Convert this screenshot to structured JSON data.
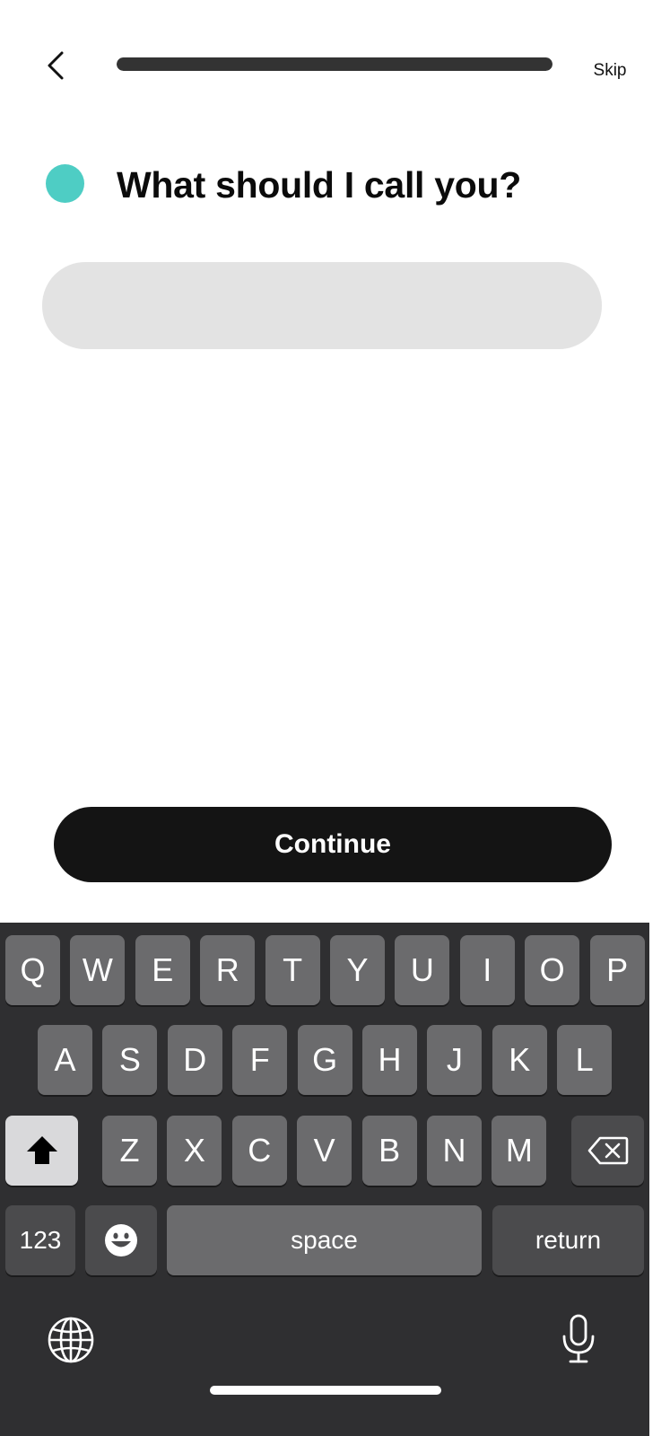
{
  "header": {
    "back_icon": "chevron-left-icon",
    "progress": 1.0,
    "skip_label": "Skip"
  },
  "question": {
    "text": "What should I call you?",
    "dot_color": "#4ecdc4"
  },
  "name_input": {
    "value": "",
    "placeholder": ""
  },
  "continue_label": "Continue",
  "keyboard": {
    "row1": [
      "Q",
      "W",
      "E",
      "R",
      "T",
      "Y",
      "U",
      "I",
      "O",
      "P"
    ],
    "row2": [
      "A",
      "S",
      "D",
      "F",
      "G",
      "H",
      "J",
      "K",
      "L"
    ],
    "row3": [
      "Z",
      "X",
      "C",
      "V",
      "B",
      "N",
      "M"
    ],
    "numbers_label": "123",
    "space_label": "space",
    "return_label": "return",
    "shift_icon": "shift-icon",
    "delete_icon": "backspace-icon",
    "emoji_icon": "emoji-icon",
    "globe_icon": "globe-icon",
    "mic_icon": "microphone-icon"
  }
}
